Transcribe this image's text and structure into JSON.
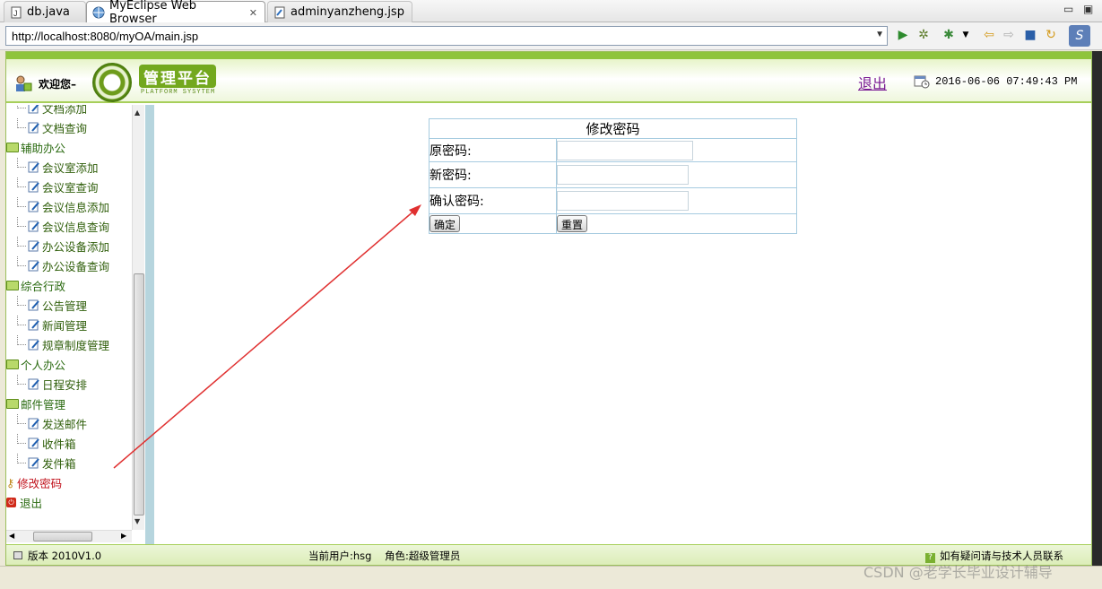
{
  "tabs": [
    {
      "label": "db.java",
      "icon": "java-file-icon"
    },
    {
      "label": "MyEclipse Web Browser",
      "icon": "globe-icon",
      "active": true
    },
    {
      "label": "adminyanzheng.jsp",
      "icon": "jsp-file-icon"
    }
  ],
  "address": {
    "url": "http://localhost:8080/myOA/main.jsp"
  },
  "header": {
    "welcome": "欢迎您–",
    "logo_title": "管理平台",
    "logo_sub": "PLATFORM SYSYTEM",
    "logout": "退出",
    "datetime": "2016-06-06 07:49:43 PM"
  },
  "nav": {
    "items": [
      {
        "label": "文档添加",
        "type": "child"
      },
      {
        "label": "文档查询",
        "type": "child"
      },
      {
        "label": "辅助办公",
        "type": "group"
      },
      {
        "label": "会议室添加",
        "type": "child"
      },
      {
        "label": "会议室查询",
        "type": "child"
      },
      {
        "label": "会议信息添加",
        "type": "child"
      },
      {
        "label": "会议信息查询",
        "type": "child"
      },
      {
        "label": "办公设备添加",
        "type": "child"
      },
      {
        "label": "办公设备查询",
        "type": "child"
      },
      {
        "label": "综合行政",
        "type": "group"
      },
      {
        "label": "公告管理",
        "type": "child"
      },
      {
        "label": "新闻管理",
        "type": "child"
      },
      {
        "label": "规章制度管理",
        "type": "child"
      },
      {
        "label": "个人办公",
        "type": "group"
      },
      {
        "label": "日程安排",
        "type": "child"
      },
      {
        "label": "邮件管理",
        "type": "group"
      },
      {
        "label": "发送邮件",
        "type": "child"
      },
      {
        "label": "收件箱",
        "type": "child"
      },
      {
        "label": "发件箱",
        "type": "child"
      },
      {
        "label": "修改密码",
        "type": "special-red"
      },
      {
        "label": "退出",
        "type": "special-exit"
      }
    ]
  },
  "form": {
    "title": "修改密码",
    "old_label": "原密码:",
    "new_label": "新密码:",
    "confirm_label": "确认密码:",
    "ok_button": "确定",
    "reset_button": "重置"
  },
  "footer": {
    "version": "版本 2010V1.0",
    "user": "当前用户:hsg",
    "role": "角色:超级管理员",
    "help": "如有疑问请与技术人员联系"
  },
  "watermark": "CSDN @老学长毕业设计辅导",
  "colors": {
    "brand_green": "#8fc43b",
    "nav_text": "#2f5e0a",
    "logout_purple": "#7a1b93",
    "table_border": "#a6cbe0",
    "annotation_red": "#e03030"
  }
}
